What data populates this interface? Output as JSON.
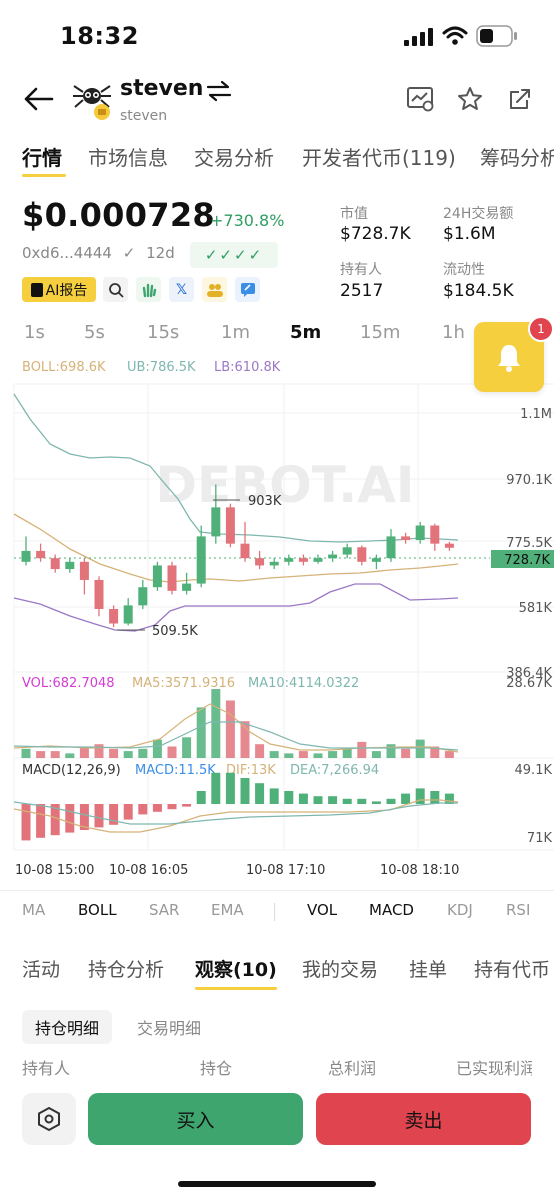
{
  "status": {
    "time": "18:32"
  },
  "header": {
    "name": "steven",
    "subname": "steven"
  },
  "top_tabs": [
    {
      "label": "行情",
      "active": true
    },
    {
      "label": "市场信息",
      "active": false
    },
    {
      "label": "交易分析",
      "active": false
    },
    {
      "label": "开发者代币(119)",
      "active": false
    },
    {
      "label": "筹码分析",
      "active": false
    }
  ],
  "token": {
    "price": "$0.000728",
    "change": "+730.8%",
    "address": "0xd6...4444",
    "check_mark": "✓",
    "age": "12d",
    "verify_checks": "✓✓✓✓"
  },
  "stats": {
    "market_cap_label": "市值",
    "market_cap": "$728.7K",
    "volume_label": "24H交易额",
    "volume": "$1.6M",
    "holders_label": "持有人",
    "holders": "2517",
    "liquidity_label": "流动性",
    "liquidity": "$184.5K"
  },
  "ai_report": "AI报告",
  "timeframes": [
    {
      "label": "1s",
      "active": false
    },
    {
      "label": "5s",
      "active": false
    },
    {
      "label": "15s",
      "active": false
    },
    {
      "label": "1m",
      "active": false
    },
    {
      "label": "5m",
      "active": true
    },
    {
      "label": "15m",
      "active": false
    },
    {
      "label": "1h",
      "active": false
    }
  ],
  "alert_badge": "1",
  "chart": {
    "watermark": "DEBOT.AI",
    "boll_legend": {
      "boll": "BOLL:698.6K",
      "ub": "UB:786.5K",
      "lb": "LB:610.8K"
    },
    "price_axis": [
      "1.1M",
      "970.1K",
      "775.5K",
      "581K",
      "386.4K"
    ],
    "current_price_tag": "728.7K",
    "high_annotation": "903K",
    "low_annotation": "509.5K",
    "vol_legend": {
      "vol": "VOL:682.7048",
      "ma5": "MA5:3571.9316",
      "ma10": "MA10:4114.0322"
    },
    "vol_axis": "28.67K",
    "macd_legend": {
      "macd_params": "MACD(12,26,9)",
      "macd": "MACD:11.5K",
      "dif": "DIF:13K",
      "dea": "DEA:7,266.94"
    },
    "macd_axis": [
      "49.1K",
      "71K"
    ],
    "time_axis": [
      "10-08 15:00",
      "10-08 16:05",
      "10-08 17:10",
      "10-08 18:10"
    ],
    "colors": {
      "up": "#4fb07a",
      "down": "#e2737b",
      "boll": "#d5b278",
      "ub": "#7eb7ae",
      "lb": "#9a78c6"
    }
  },
  "chart_data": {
    "type": "candlestick",
    "interval": "5m",
    "unit": "market cap (USD)",
    "candles_approx": [
      {
        "o": 690,
        "c": 720,
        "h": 760,
        "l": 680
      },
      {
        "o": 720,
        "c": 700,
        "h": 740,
        "l": 690
      },
      {
        "o": 700,
        "c": 670,
        "h": 710,
        "l": 660
      },
      {
        "o": 670,
        "c": 690,
        "h": 700,
        "l": 660
      },
      {
        "o": 690,
        "c": 640,
        "h": 700,
        "l": 600
      },
      {
        "o": 640,
        "c": 560,
        "h": 650,
        "l": 540
      },
      {
        "o": 560,
        "c": 520,
        "h": 570,
        "l": 510
      },
      {
        "o": 520,
        "c": 570,
        "h": 590,
        "l": 515
      },
      {
        "o": 570,
        "c": 620,
        "h": 640,
        "l": 560
      },
      {
        "o": 620,
        "c": 680,
        "h": 690,
        "l": 610
      },
      {
        "o": 680,
        "c": 610,
        "h": 690,
        "l": 600
      },
      {
        "o": 610,
        "c": 630,
        "h": 660,
        "l": 600
      },
      {
        "o": 630,
        "c": 760,
        "h": 790,
        "l": 620
      },
      {
        "o": 760,
        "c": 840,
        "h": 903,
        "l": 740
      },
      {
        "o": 840,
        "c": 740,
        "h": 850,
        "l": 730
      },
      {
        "o": 740,
        "c": 700,
        "h": 800,
        "l": 690
      },
      {
        "o": 700,
        "c": 680,
        "h": 720,
        "l": 670
      },
      {
        "o": 680,
        "c": 690,
        "h": 700,
        "l": 670
      },
      {
        "o": 690,
        "c": 700,
        "h": 710,
        "l": 680
      },
      {
        "o": 700,
        "c": 690,
        "h": 710,
        "l": 680
      },
      {
        "o": 690,
        "c": 700,
        "h": 710,
        "l": 685
      },
      {
        "o": 700,
        "c": 710,
        "h": 720,
        "l": 690
      },
      {
        "o": 710,
        "c": 730,
        "h": 740,
        "l": 700
      },
      {
        "o": 730,
        "c": 690,
        "h": 735,
        "l": 680
      },
      {
        "o": 690,
        "c": 700,
        "h": 710,
        "l": 670
      },
      {
        "o": 700,
        "c": 760,
        "h": 780,
        "l": 690
      },
      {
        "o": 760,
        "c": 750,
        "h": 770,
        "l": 740
      },
      {
        "o": 750,
        "c": 790,
        "h": 800,
        "l": 740
      },
      {
        "o": 790,
        "c": 740,
        "h": 795,
        "l": 720
      },
      {
        "o": 740,
        "c": 728.7,
        "h": 745,
        "l": 720
      }
    ]
  },
  "indicators": [
    {
      "label": "MA",
      "active": false
    },
    {
      "label": "BOLL",
      "active": true
    },
    {
      "label": "SAR",
      "active": false
    },
    {
      "label": "EMA",
      "active": false
    },
    {
      "label": "VOL",
      "active": true
    },
    {
      "label": "MACD",
      "active": true
    },
    {
      "label": "KDJ",
      "active": false
    },
    {
      "label": "RSI",
      "active": false
    }
  ],
  "bottom_tabs": [
    {
      "label": "活动",
      "active": false
    },
    {
      "label": "持仓分析",
      "active": false
    },
    {
      "label": "观察(10)",
      "active": true
    },
    {
      "label": "我的交易",
      "active": false
    },
    {
      "label": "挂单",
      "active": false
    },
    {
      "label": "持有代币",
      "active": false
    }
  ],
  "sub_tabs": [
    {
      "label": "持仓明细",
      "active": true
    },
    {
      "label": "交易明细",
      "active": false
    }
  ],
  "columns": [
    "持有人",
    "持仓",
    "总利润",
    "已实现利润"
  ],
  "actions": {
    "buy": "买入",
    "sell": "卖出"
  }
}
